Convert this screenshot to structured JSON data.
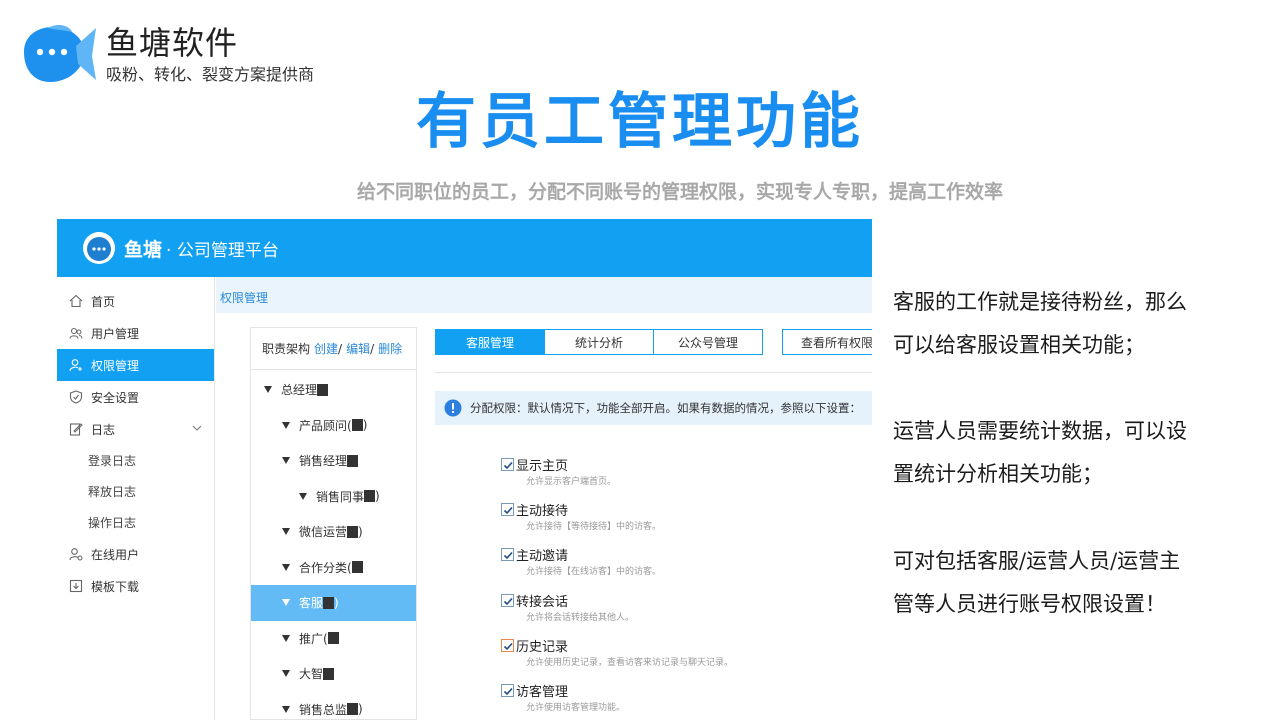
{
  "brand": {
    "name": "鱼塘软件",
    "tagline": "吸粉、转化、裂变方案提供商"
  },
  "headline": {
    "title": "有员工管理功能",
    "subtitle": "给不同职位的员工，分配不同账号的管理权限，实现专人专职，提高工作效率"
  },
  "app": {
    "header": {
      "name": "鱼塘",
      "subtitle": "· 公司管理平台"
    },
    "nav": [
      {
        "label": "首页",
        "icon": "home-icon"
      },
      {
        "label": "用户管理",
        "icon": "users-icon"
      },
      {
        "label": "权限管理",
        "icon": "permission-user-icon"
      },
      {
        "label": "安全设置",
        "icon": "shield-icon"
      },
      {
        "label": "日志",
        "icon": "edit-log-icon"
      },
      {
        "label": "登录日志"
      },
      {
        "label": "释放日志"
      },
      {
        "label": "操作日志"
      },
      {
        "label": "在线用户",
        "icon": "online-user-icon"
      },
      {
        "label": "模板下载",
        "icon": "download-icon"
      }
    ],
    "breadcrumb": "权限管理",
    "tree": {
      "header_label": "职责架构",
      "create": "创建",
      "edit": "编辑",
      "delete": "删除",
      "sep": "/",
      "nodes": [
        {
          "label": "总经理",
          "suffix": ""
        },
        {
          "label": "产品顾问(",
          "suffix": ")"
        },
        {
          "label": "销售经理",
          "suffix": ""
        },
        {
          "label": "销售同事",
          "suffix": ")"
        },
        {
          "label": "微信运营",
          "suffix": ")"
        },
        {
          "label": "合作分类(",
          "suffix": ""
        },
        {
          "label": "客服",
          "suffix": ")"
        },
        {
          "label": "推广(",
          "suffix": ""
        },
        {
          "label": "大智",
          "suffix": ""
        },
        {
          "label": "销售总监",
          "suffix": ")"
        }
      ]
    },
    "tabs": [
      "客服管理",
      "统计分析",
      "公众号管理"
    ],
    "view_all": "查看所有权限",
    "notice": "分配权限：默认情况下，功能全部开启。如果有数据的情况，参照以下设置：",
    "permissions": [
      {
        "title": "显示主页",
        "desc": "允许显示客户端首页。"
      },
      {
        "title": "主动接待",
        "desc": "允许接待【等待接待】中的访客。"
      },
      {
        "title": "主动邀请",
        "desc": "允许接待【在线访客】中的访客。"
      },
      {
        "title": "转接会话",
        "desc": "允许将会话转接给其他人。"
      },
      {
        "title": "历史记录",
        "desc": "允许使用历史记录，查看访客来访记录与聊天记录。"
      },
      {
        "title": "访客管理",
        "desc": "允许使用访客管理功能。"
      }
    ]
  },
  "description": {
    "p1_line1": "客服的工作就是接待粉丝，那么",
    "p1_line2": "可以给客服设置相关功能；",
    "p2_line1": "运营人员需要统计数据，可以设",
    "p2_line2": "置统计分析相关功能；",
    "p3_line1": "可对包括客服/运营人员/运营主",
    "p3_line2": "管等人员进行账号权限设置！"
  },
  "colors": {
    "brand_blue": "#1a8ef0",
    "app_header": "#12a1f2",
    "selected_node": "#62bbf4",
    "subtitle_gray": "#a8a8a8"
  }
}
